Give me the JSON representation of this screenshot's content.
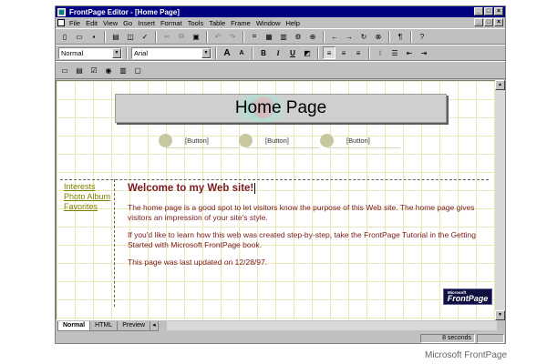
{
  "window": {
    "title": "FrontPage Editor - [Home Page]",
    "controls": {
      "minimize": "_",
      "maximize": "□",
      "close": "×"
    }
  },
  "menu": {
    "items": [
      "File",
      "Edit",
      "View",
      "Go",
      "Insert",
      "Format",
      "Tools",
      "Table",
      "Frame",
      "Window",
      "Help"
    ]
  },
  "toolbar": {
    "style_value": "Normal",
    "font_value": "Arial",
    "bold_label": "B",
    "italic_label": "I",
    "underline_label": "U",
    "increase_font_label": "A",
    "decrease_font_label": "A",
    "pilcrow_label": "¶"
  },
  "page": {
    "banner_title": "Home Page",
    "nav_buttons": [
      "[Button]",
      "[Button]",
      "[Button]"
    ],
    "side_links": [
      "Interests",
      "Photo Album",
      "Favorites"
    ],
    "heading": "Welcome to my Web site!",
    "paragraphs": [
      "The home page is a good spot to let visitors know the purpose of this Web site. The home page gives visitors an impression of your site's style.",
      "If you'd like to learn how this web was created step-by-step, take the FrontPage Tutorial in the Getting Started with Microsoft FrontPage book.",
      "This page was last updated on 12/28/97."
    ],
    "logo_small": "Microsoft",
    "logo_big": "FrontPage"
  },
  "tabs": [
    "Normal",
    "HTML",
    "Preview"
  ],
  "status": {
    "time": "8 seconds"
  },
  "caption": "Microsoft FrontPage",
  "colors": {
    "title_bar": "#000080",
    "body_text": "#7a1a20",
    "link": "#808000",
    "chrome": "#c0c0c0"
  }
}
